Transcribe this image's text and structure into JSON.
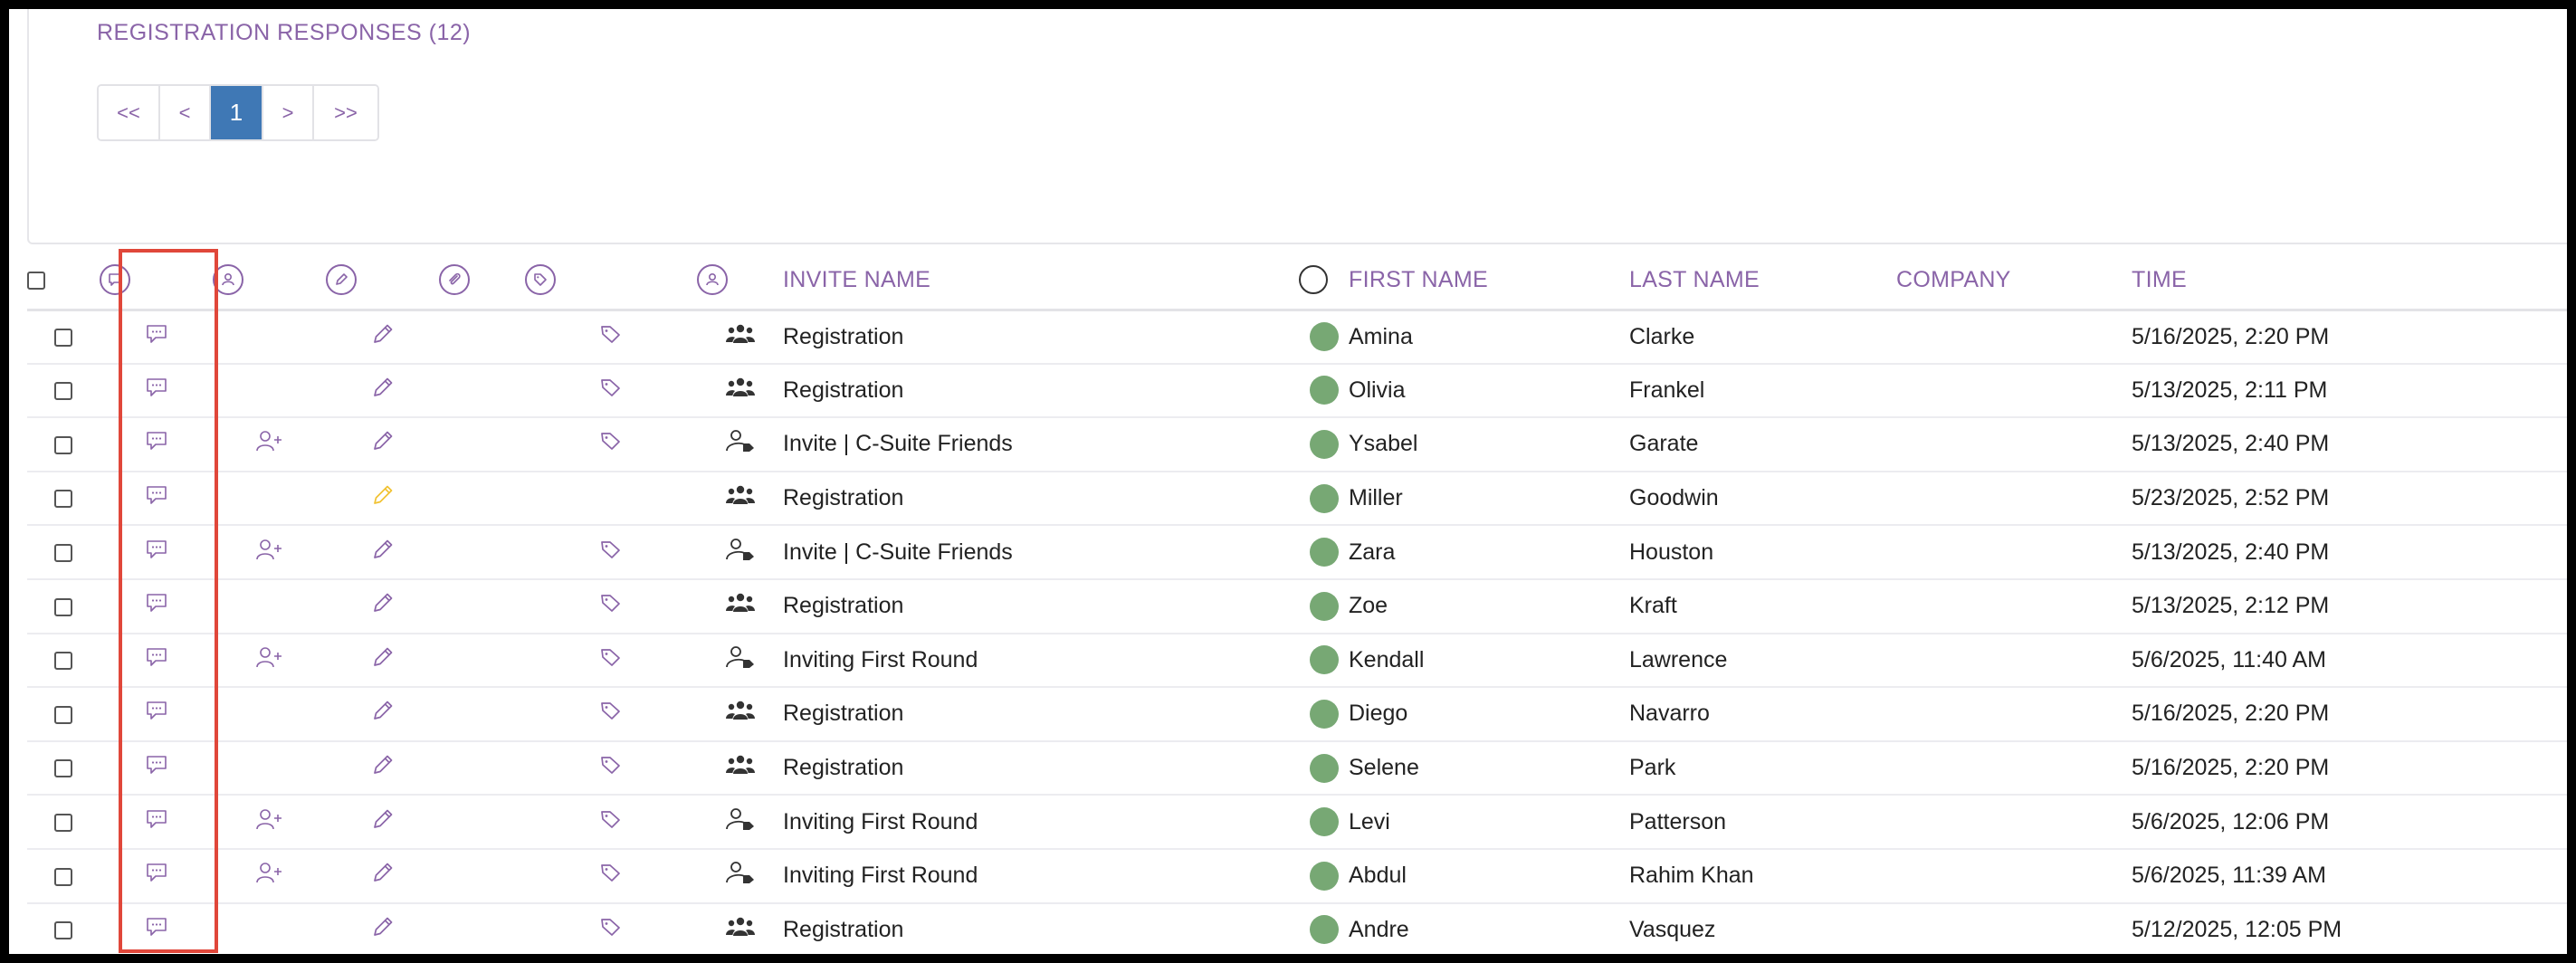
{
  "section": {
    "title": "REGISTRATION RESPONSES (12)"
  },
  "pager": {
    "first": "<<",
    "prev": "<",
    "current": "1",
    "next": ">",
    "last": ">>"
  },
  "columns": {
    "comment_icon": "comment-icon",
    "assign_icon": "user-icon",
    "edit_icon": "pencil-icon",
    "attach_icon": "paperclip-icon",
    "tag_icon": "tag-icon",
    "type_icon": "user-icon",
    "invite_name": "INVITE NAME",
    "status_icon": "circle-icon",
    "first_name": "FIRST NAME",
    "last_name": "LAST NAME",
    "company": "COMPANY",
    "time": "TIME"
  },
  "colors": {
    "accent": "#8a64a8",
    "pager_active": "#3f78b5",
    "status_dot": "#77a874",
    "edit_highlight": "#f1c232",
    "highlight_box": "#e0473a"
  },
  "rows": [
    {
      "invite": "Registration",
      "first": "Amina",
      "last": "Clarke",
      "company": "",
      "time": "5/16/2025, 2:20 PM",
      "added": false,
      "tag": true,
      "edit_yellow": false,
      "group": true
    },
    {
      "invite": "Registration",
      "first": "Olivia",
      "last": "Frankel",
      "company": "",
      "time": "5/13/2025, 2:11 PM",
      "added": false,
      "tag": true,
      "edit_yellow": false,
      "group": true
    },
    {
      "invite": "Invite | C-Suite Friends",
      "first": "Ysabel",
      "last": "Garate",
      "company": "",
      "time": "5/13/2025, 2:40 PM",
      "added": true,
      "tag": true,
      "edit_yellow": false,
      "group": false
    },
    {
      "invite": "Registration",
      "first": "Miller",
      "last": "Goodwin",
      "company": "",
      "time": "5/23/2025, 2:52 PM",
      "added": false,
      "tag": false,
      "edit_yellow": true,
      "group": true
    },
    {
      "invite": "Invite | C-Suite Friends",
      "first": "Zara",
      "last": "Houston",
      "company": "",
      "time": "5/13/2025, 2:40 PM",
      "added": true,
      "tag": true,
      "edit_yellow": false,
      "group": false
    },
    {
      "invite": "Registration",
      "first": "Zoe",
      "last": "Kraft",
      "company": "",
      "time": "5/13/2025, 2:12 PM",
      "added": false,
      "tag": true,
      "edit_yellow": false,
      "group": true
    },
    {
      "invite": "Inviting First Round",
      "first": "Kendall",
      "last": "Lawrence",
      "company": "",
      "time": "5/6/2025, 11:40 AM",
      "added": true,
      "tag": true,
      "edit_yellow": false,
      "group": false
    },
    {
      "invite": "Registration",
      "first": "Diego",
      "last": "Navarro",
      "company": "",
      "time": "5/16/2025, 2:20 PM",
      "added": false,
      "tag": true,
      "edit_yellow": false,
      "group": true
    },
    {
      "invite": "Registration",
      "first": "Selene",
      "last": "Park",
      "company": "",
      "time": "5/16/2025, 2:20 PM",
      "added": false,
      "tag": true,
      "edit_yellow": false,
      "group": true
    },
    {
      "invite": "Inviting First Round",
      "first": "Levi",
      "last": "Patterson",
      "company": "",
      "time": "5/6/2025, 12:06 PM",
      "added": true,
      "tag": true,
      "edit_yellow": false,
      "group": false
    },
    {
      "invite": "Inviting First Round",
      "first": "Abdul",
      "last": "Rahim Khan",
      "company": "",
      "time": "5/6/2025, 11:39 AM",
      "added": true,
      "tag": true,
      "edit_yellow": false,
      "group": false
    },
    {
      "invite": "Registration",
      "first": "Andre",
      "last": "Vasquez",
      "company": "",
      "time": "5/12/2025, 12:05 PM",
      "added": false,
      "tag": true,
      "edit_yellow": false,
      "group": true
    }
  ]
}
